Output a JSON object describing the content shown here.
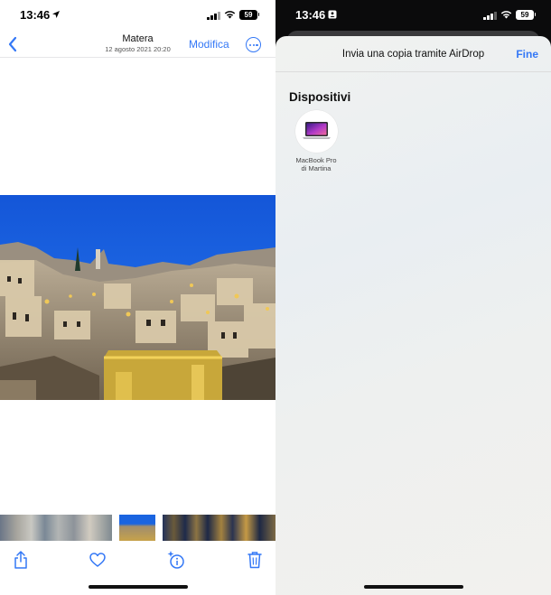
{
  "left": {
    "status": {
      "time": "13:46",
      "battery": "59"
    },
    "nav": {
      "title": "Matera",
      "subtitle": "12 agosto 2021  20:20",
      "edit_label": "Modifica"
    }
  },
  "right": {
    "status": {
      "time": "13:46",
      "battery": "59"
    },
    "sheet": {
      "title": "Invia una copia tramite AirDrop",
      "done_label": "Fine",
      "section_title": "Dispositivi",
      "devices": [
        {
          "line1": "MacBook Pro",
          "line2": "di Martina"
        }
      ]
    }
  },
  "colors": {
    "accent": "#3478f6",
    "sky": "#1a64e0",
    "city_lights": "#e8c25a"
  },
  "icons": [
    "location-arrow-icon",
    "signal-icon",
    "wifi-icon",
    "battery-icon",
    "back-chevron-icon",
    "more-icon",
    "share-icon",
    "heart-icon",
    "info-sparkle-icon",
    "trash-icon",
    "macbook-icon"
  ]
}
